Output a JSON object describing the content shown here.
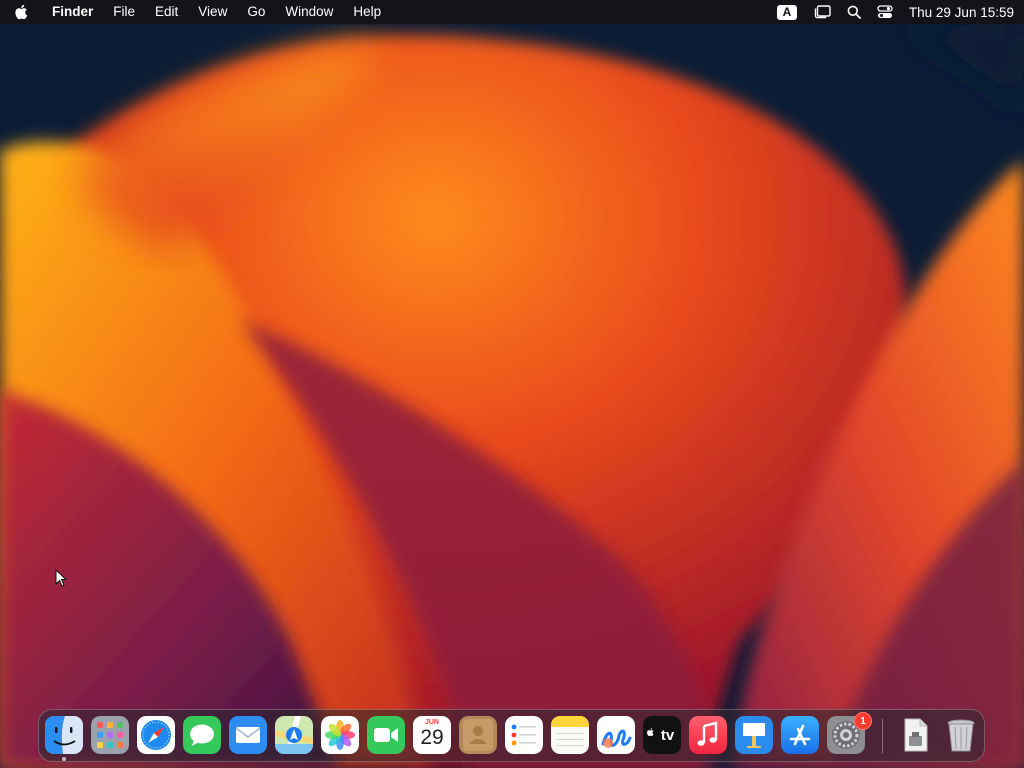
{
  "menubar": {
    "app_name": "Finder",
    "menus": [
      "File",
      "Edit",
      "View",
      "Go",
      "Window",
      "Help"
    ],
    "input_source": "A",
    "clock": "Thu 29 Jun  15:59"
  },
  "dock": {
    "items": [
      {
        "name": "Finder",
        "icon": "finder-icon"
      },
      {
        "name": "Launchpad",
        "icon": "launchpad-icon"
      },
      {
        "name": "Safari",
        "icon": "safari-icon"
      },
      {
        "name": "Messages",
        "icon": "messages-icon"
      },
      {
        "name": "Mail",
        "icon": "mail-icon"
      },
      {
        "name": "Maps",
        "icon": "maps-icon"
      },
      {
        "name": "Photos",
        "icon": "photos-icon"
      },
      {
        "name": "FaceTime",
        "icon": "facetime-icon"
      },
      {
        "name": "Calendar",
        "icon": "calendar-icon"
      },
      {
        "name": "Contacts",
        "icon": "contacts-icon"
      },
      {
        "name": "Reminders",
        "icon": "reminders-icon"
      },
      {
        "name": "Notes",
        "icon": "notes-icon"
      },
      {
        "name": "Freeform",
        "icon": "freeform-icon"
      },
      {
        "name": "TV",
        "icon": "tv-icon"
      },
      {
        "name": "Music",
        "icon": "music-icon"
      },
      {
        "name": "Keynote",
        "icon": "keynote-icon"
      },
      {
        "name": "App Store",
        "icon": "app-store-icon"
      },
      {
        "name": "System Settings",
        "icon": "settings-icon"
      },
      {
        "name": "Downloads",
        "icon": "downloads-stack-icon"
      },
      {
        "name": "Trash",
        "icon": "trash-icon"
      }
    ],
    "calendar": {
      "month": "JUN",
      "day": "29"
    },
    "tv_label": "tv",
    "settings_badge": "1"
  }
}
